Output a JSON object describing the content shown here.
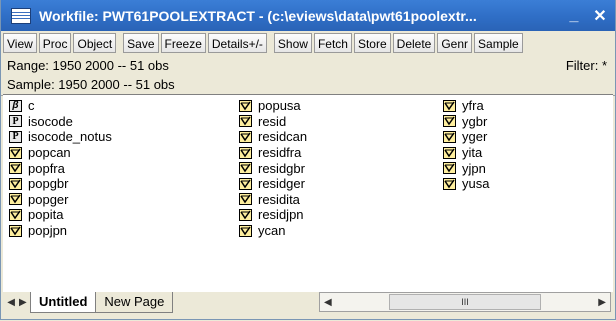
{
  "window": {
    "title": "Workfile: PWT61POOLEXTRACT - (c:\\eviews\\data\\pwt61poolextr...",
    "minimize": "_",
    "close": "✕"
  },
  "toolbar": {
    "buttons": [
      "View",
      "Proc",
      "Object",
      "Save",
      "Freeze",
      "Details+/-",
      "Show",
      "Fetch",
      "Store",
      "Delete",
      "Genr",
      "Sample"
    ]
  },
  "info": {
    "range": "Range:  1950 2000  --  51 obs",
    "sample": "Sample: 1950 2000  --  51 obs",
    "filter": "Filter: *"
  },
  "objects": {
    "col1": [
      {
        "icon": "coef",
        "name": "c"
      },
      {
        "icon": "alpha",
        "name": "isocode"
      },
      {
        "icon": "alpha",
        "name": "isocode_notus"
      },
      {
        "icon": "series",
        "name": "popcan"
      },
      {
        "icon": "series",
        "name": "popfra"
      },
      {
        "icon": "series",
        "name": "popgbr"
      },
      {
        "icon": "series",
        "name": "popger"
      },
      {
        "icon": "series",
        "name": "popita"
      },
      {
        "icon": "series",
        "name": "popjpn"
      }
    ],
    "col2": [
      {
        "icon": "series",
        "name": "popusa"
      },
      {
        "icon": "series",
        "name": "resid"
      },
      {
        "icon": "series",
        "name": "residcan"
      },
      {
        "icon": "series",
        "name": "residfra"
      },
      {
        "icon": "series",
        "name": "residgbr"
      },
      {
        "icon": "series",
        "name": "residger"
      },
      {
        "icon": "series",
        "name": "residita"
      },
      {
        "icon": "series",
        "name": "residjpn"
      },
      {
        "icon": "series",
        "name": "ycan"
      }
    ],
    "col3": [
      {
        "icon": "series",
        "name": "yfra"
      },
      {
        "icon": "series",
        "name": "ygbr"
      },
      {
        "icon": "series",
        "name": "yger"
      },
      {
        "icon": "series",
        "name": "yita"
      },
      {
        "icon": "series",
        "name": "yjpn"
      },
      {
        "icon": "series",
        "name": "yusa"
      }
    ]
  },
  "tabs": [
    "Untitled",
    "New Page"
  ],
  "scroll": {
    "thumb_label": "III"
  }
}
